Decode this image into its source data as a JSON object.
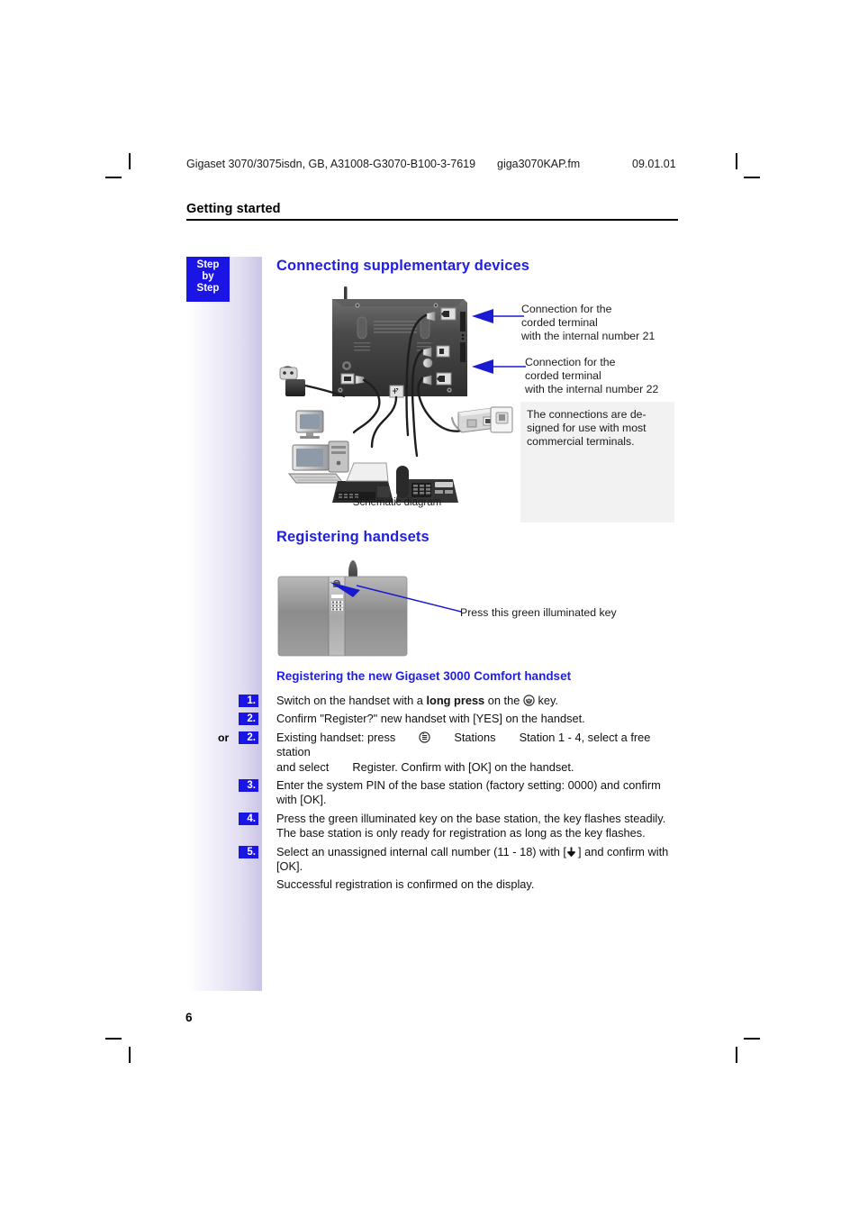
{
  "header": {
    "document_id": "Gigaset 3070/3075isdn, GB, A31008-G3070-B100-3-7619",
    "filename": "giga3070KAP.fm",
    "date": "09.01.01"
  },
  "chapter_title": "Getting started",
  "side_tab": {
    "line1": "Step",
    "line2": "by",
    "line3": "Step"
  },
  "sections": {
    "connecting": {
      "heading": "Connecting supplementary devices",
      "schematic_caption": "Schematic diagram",
      "callouts": [
        "Connection for the\ncorded terminal\nwith the internal number 21",
        "Connection for the\ncorded terminal\nwith the internal number 22"
      ],
      "callout1_line1": "Connection for the",
      "callout1_line2": "corded terminal",
      "callout1_line3": "with the internal number 21",
      "callout2_line1": "Connection for the",
      "callout2_line2": "corded terminal",
      "callout2_line3": "with the internal number 22",
      "note": "The connections are de-signed for use with most commercial terminals.",
      "note_line1": "The connections are de-",
      "note_line2": "signed for use with most",
      "note_line3": "commercial terminals."
    },
    "registering": {
      "heading": "Registering handsets",
      "key_caption": "Press this green illuminated key",
      "subheading": "Registering the new Gigaset 3000 Comfort handset",
      "steps": [
        {
          "number": "1.",
          "or": "",
          "text": "Switch on the handset with a long press on the ⌘ key."
        },
        {
          "number": "2.",
          "or": "",
          "text": "Confirm \"Register?\" new handset with [YES] on the handset."
        },
        {
          "number": "2.",
          "or": "or",
          "text": "Existing handset: press ☰ Stations Station 1 - 4, select a free station and select Register. Confirm with [OK] on the handset."
        },
        {
          "number": "3.",
          "or": "",
          "text": "Enter the system PIN of the base station (factory setting: 0000) and confirm with [OK]."
        },
        {
          "number": "4.",
          "or": "",
          "text": "Press the green illuminated key on the base station, the key flashes steadily. The base station is only ready for registration as long as the key flashes."
        },
        {
          "number": "5.",
          "or": "",
          "text": "Select an unassigned internal call number (11 - 18) with [↓] and confirm with [OK]."
        }
      ],
      "step1_a": "Switch on the handset with a ",
      "step1_b": "long press",
      "step1_c": " on the ",
      "step1_d": " key.",
      "step2": "Confirm \"Register?\" new handset with [YES] on the handset.",
      "step2b_a": "Existing handset: press",
      "step2b_b": "Stations",
      "step2b_c": "Station 1 - 4, select a free station",
      "step2b_d": "and select",
      "step2b_e": "Register. Confirm with [OK] on the handset.",
      "step3_a": "Enter the system PIN of the base station (factory setting: 0000) and confirm",
      "step3_b": "with [OK].",
      "step4_a": "Press the green illuminated key on the base station, the key flashes steadily.",
      "step4_b": "The base station is only ready for registration as long as the key flashes.",
      "step5_a": "Select an unassigned internal call number (11 - 18) with [",
      "step5_b": "] and confirm with",
      "step5_c": "[OK].",
      "closing": "Successful registration is confirmed on the display.",
      "or_label": "or"
    }
  },
  "page_number": "6",
  "colors": {
    "heading_blue": "#2220dd",
    "chip_blue": "#1a15e4",
    "note_gray": "#f2f2f2",
    "gradient_end": "#cbc4e6",
    "arrow_blue": "#1a1ad0"
  },
  "icons": {
    "hangup_key": "phone-hangup-key-icon",
    "menu_key": "menu-key-icon",
    "down_arrow": "down-arrow-icon"
  }
}
